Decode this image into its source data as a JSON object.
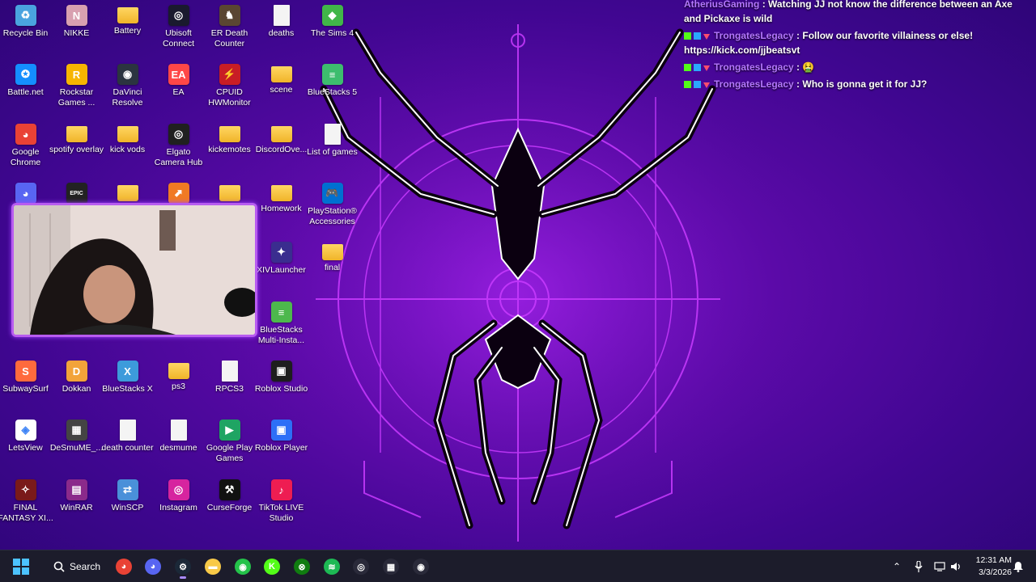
{
  "desktop": {
    "icons": [
      {
        "label": "Recycle Bin",
        "color": "#4aa3df",
        "glyph": "♻"
      },
      {
        "label": "NIKKE",
        "color": "#d8a0b0",
        "glyph": "N"
      },
      {
        "label": "Battery",
        "color": "folder",
        "glyph": ""
      },
      {
        "label": "Ubisoft Connect",
        "color": "#1a1a2e",
        "glyph": "◎"
      },
      {
        "label": "ER Death Counter",
        "color": "#5a4632",
        "glyph": "♞"
      },
      {
        "label": "deaths",
        "color": "file",
        "glyph": ""
      },
      {
        "label": "The Sims 4",
        "color": "#41b649",
        "glyph": "◆"
      },
      {
        "label": "Battle.net",
        "color": "#148eff",
        "glyph": "✪"
      },
      {
        "label": "Rockstar Games ...",
        "color": "#f7b500",
        "glyph": "R"
      },
      {
        "label": "DaVinci Resolve",
        "color": "#2b3440",
        "glyph": "◉"
      },
      {
        "label": "EA",
        "color": "#ff4747",
        "glyph": "EA"
      },
      {
        "label": "CPUID HWMonitor",
        "color": "#c81d25",
        "glyph": "⚡"
      },
      {
        "label": "scene",
        "color": "folder",
        "glyph": ""
      },
      {
        "label": "BlueStacks 5",
        "color": "#3dbd6e",
        "glyph": "≡"
      },
      {
        "label": "Google Chrome",
        "color": "#e94235",
        "glyph": "◕"
      },
      {
        "label": "spotify overlay",
        "color": "folder",
        "glyph": ""
      },
      {
        "label": "kick vods",
        "color": "folder",
        "glyph": ""
      },
      {
        "label": "Elgato Camera Hub",
        "color": "#202020",
        "glyph": "◎"
      },
      {
        "label": "kickemotes",
        "color": "folder",
        "glyph": ""
      },
      {
        "label": "DiscordOve...",
        "color": "folder",
        "glyph": ""
      },
      {
        "label": "List of games",
        "color": "file",
        "glyph": ""
      },
      {
        "label": "Homework",
        "color": "folder",
        "glyph": ""
      },
      {
        "label": "PlayStation® Accessories",
        "color": "#0070d1",
        "glyph": "🎮"
      },
      {
        "label": "XIVLauncher",
        "color": "#3a2d8f",
        "glyph": "✦"
      },
      {
        "label": "final",
        "color": "folder",
        "glyph": ""
      },
      {
        "label": "BlueStacks Multi-Insta...",
        "color": "#4db84d",
        "glyph": "≡"
      },
      {
        "label": "SubwaySurf",
        "color": "#ff6a3d",
        "glyph": "S"
      },
      {
        "label": "Dokkan",
        "color": "#f2a33a",
        "glyph": "D"
      },
      {
        "label": "BlueStacks X",
        "color": "#3d9bdb",
        "glyph": "X"
      },
      {
        "label": "ps3",
        "color": "folder",
        "glyph": ""
      },
      {
        "label": "RPCS3",
        "color": "file",
        "glyph": ""
      },
      {
        "label": "Roblox Studio",
        "color": "#1e1e1e",
        "glyph": "▣"
      },
      {
        "label": "LetsView",
        "color": "#ffffff",
        "glyph": "◈"
      },
      {
        "label": "DeSmuME_...",
        "color": "#444444",
        "glyph": "▦"
      },
      {
        "label": "death counter",
        "color": "file",
        "glyph": ""
      },
      {
        "label": "desmume",
        "color": "file",
        "glyph": ""
      },
      {
        "label": "Google Play Games",
        "color": "#1fa463",
        "glyph": "▶"
      },
      {
        "label": "Roblox Player",
        "color": "#2d6ff7",
        "glyph": "▣"
      },
      {
        "label": "FINAL FANTASY XI...",
        "color": "#7a1a1a",
        "glyph": "✧"
      },
      {
        "label": "WinRAR",
        "color": "#8b2a8b",
        "glyph": "▤"
      },
      {
        "label": "WinSCP",
        "color": "#4a90d9",
        "glyph": "⇄"
      },
      {
        "label": "Instagram",
        "color": "#d6249f",
        "glyph": "◎"
      },
      {
        "label": "CurseForge",
        "color": "#111111",
        "glyph": "⚒"
      },
      {
        "label": "TikTok LIVE Studio",
        "color": "#ee1d52",
        "glyph": "♪"
      }
    ],
    "partial_icons": [
      {
        "name": "discord-desktop-icon",
        "color": "#5865f2",
        "glyph": "◕"
      },
      {
        "name": "epic-games-desktop-icon",
        "color": "#222222",
        "glyph": "EPIC"
      },
      {
        "name": "folder-desktop-icon",
        "color": "folder",
        "glyph": ""
      },
      {
        "name": "app-desktop-icon",
        "color": "#f07a24",
        "glyph": "⬈"
      },
      {
        "name": "folder-desktop-icon",
        "color": "folder",
        "glyph": ""
      }
    ]
  },
  "chat": {
    "messages": [
      {
        "user": "AtheriusGaming",
        "text": ": Watching JJ not know the difference between an Axe and Pickaxe is wild"
      },
      {
        "user": "TrongatesLegacy",
        "text": ": Follow our favorite villainess or else! https://kick.com/jjbeatsvt"
      },
      {
        "user": "TrongatesLegacy",
        "text": ": 🤮"
      },
      {
        "user": "TrongatesLegacy",
        "text": ": Who is gonna get it for JJ?"
      }
    ]
  },
  "taskbar": {
    "search_label": "Search",
    "apps": [
      {
        "name": "chrome-taskbar-icon",
        "color": "#e94235",
        "glyph": "◕"
      },
      {
        "name": "discord-taskbar-icon",
        "color": "#5865f2",
        "glyph": "◕"
      },
      {
        "name": "steam-taskbar-icon",
        "color": "#1b2838",
        "glyph": "⚙"
      },
      {
        "name": "file-explorer-taskbar-icon",
        "color": "#f8c948",
        "glyph": "▬"
      },
      {
        "name": "obs-green-taskbar-icon",
        "color": "#24c24a",
        "glyph": "◉"
      },
      {
        "name": "kick-taskbar-icon",
        "color": "#53fc18",
        "glyph": "K"
      },
      {
        "name": "xbox-taskbar-icon",
        "color": "#107c10",
        "glyph": "⊗"
      },
      {
        "name": "spotify-taskbar-icon",
        "color": "#1db954",
        "glyph": "≋"
      },
      {
        "name": "webcam-app-taskbar-icon",
        "color": "#2a2a3a",
        "glyph": "◎"
      },
      {
        "name": "audio-mixer-taskbar-icon",
        "color": "#2a2a3a",
        "glyph": "▦"
      },
      {
        "name": "obs-taskbar-icon",
        "color": "#2a2a3a",
        "glyph": "◉"
      }
    ],
    "clock_time": "12:31 AM",
    "clock_date": "3/3/2026"
  }
}
